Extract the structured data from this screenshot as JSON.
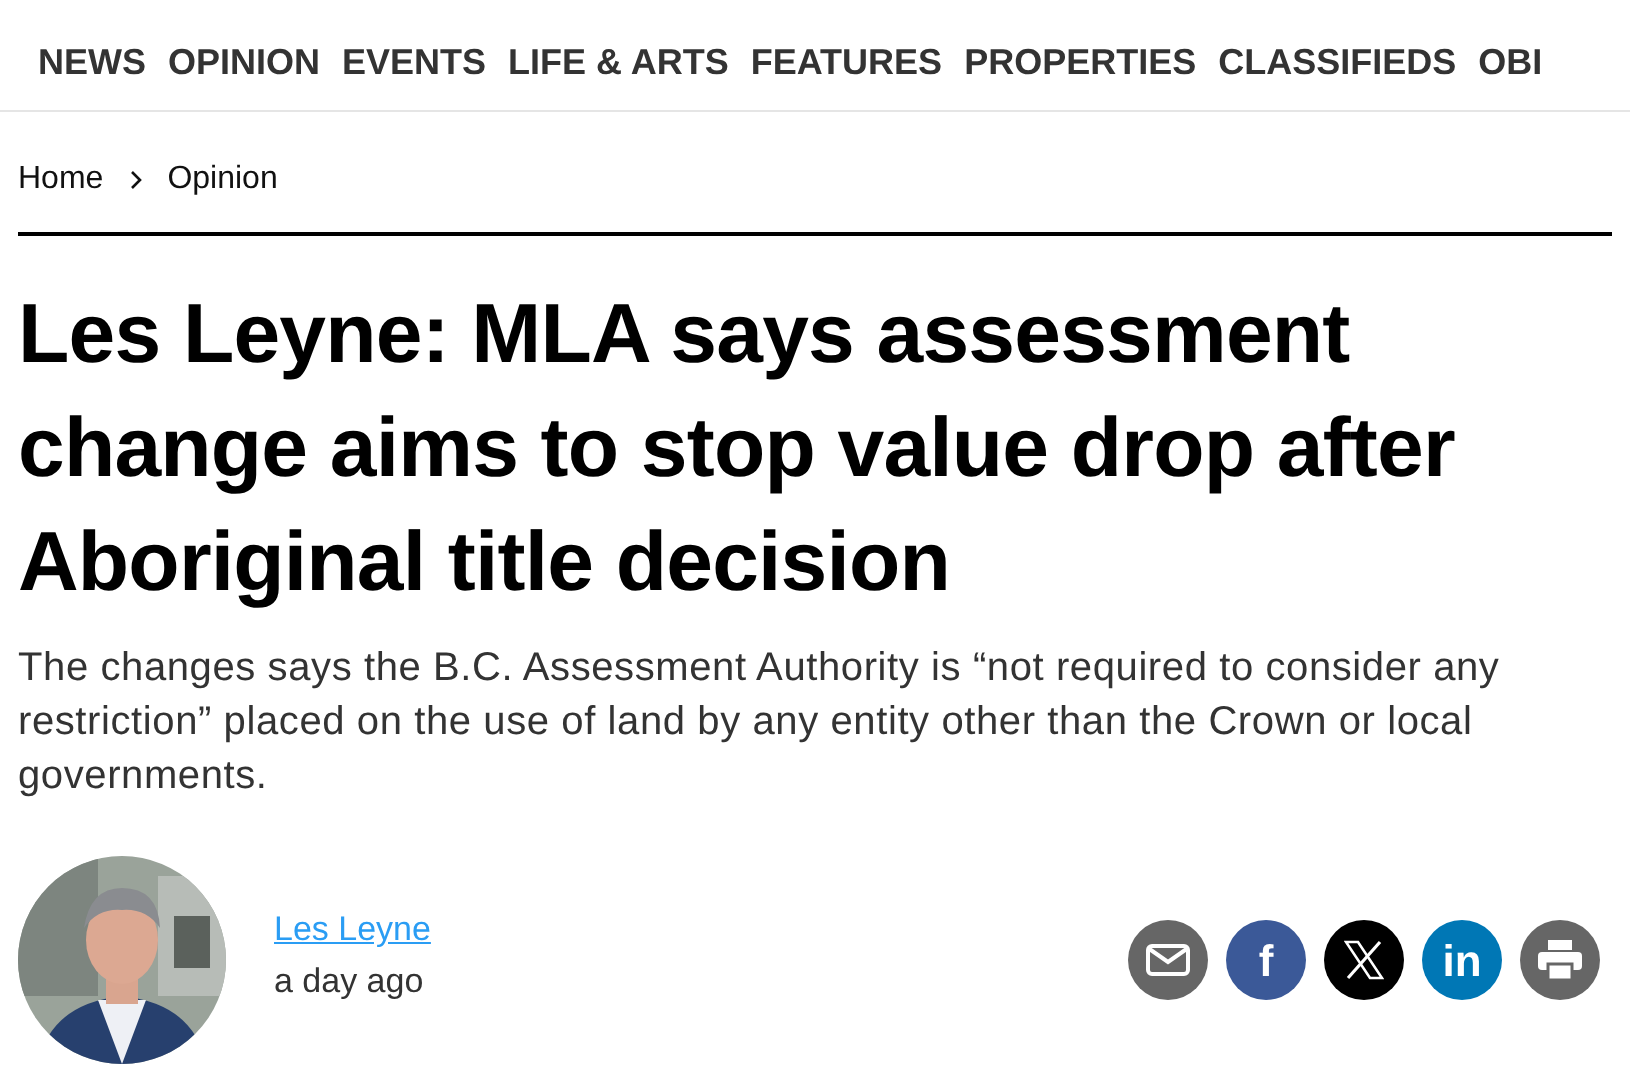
{
  "nav": [
    {
      "label": "NEWS"
    },
    {
      "label": "OPINION"
    },
    {
      "label": "EVENTS"
    },
    {
      "label": "LIFE & ARTS"
    },
    {
      "label": "FEATURES"
    },
    {
      "label": "PROPERTIES"
    },
    {
      "label": "CLASSIFIEDS"
    },
    {
      "label": "OBI"
    }
  ],
  "breadcrumb": [
    {
      "label": "Home"
    },
    {
      "label": "Opinion"
    }
  ],
  "headline": "Les Leyne: MLA says assessment change aims to stop value drop after Aboriginal title decision",
  "summary": "The changes says the B.C. Assessment Authority is “not required to consider any restriction” placed on the use of land by any entity other than the Crown or local governments.",
  "author": {
    "name": "Les Leyne",
    "time": "a day ago"
  },
  "share": [
    {
      "kind": "email",
      "color": "#666666"
    },
    {
      "kind": "facebook",
      "label": "f",
      "color": "#3b5998"
    },
    {
      "kind": "x",
      "color": "#000000"
    },
    {
      "kind": "linkedin",
      "label": "in",
      "color": "#0077b5"
    },
    {
      "kind": "print",
      "color": "#666666"
    }
  ]
}
